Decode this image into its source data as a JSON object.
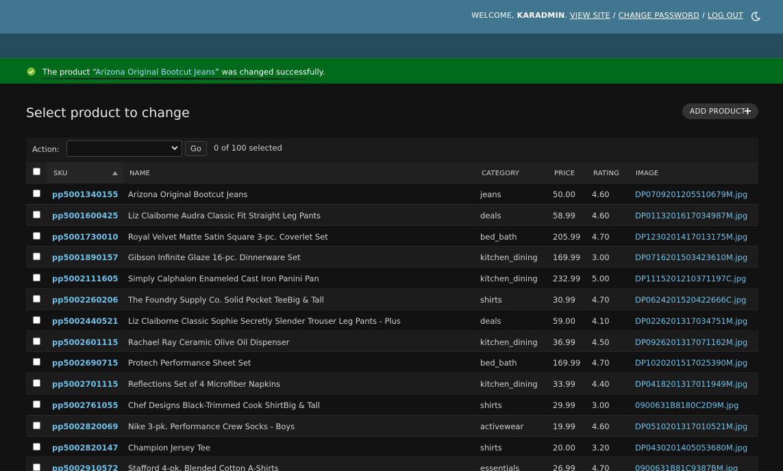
{
  "header": {
    "welcome": "WELCOME,",
    "username": "KARADMIN",
    "view_site": "VIEW SITE",
    "change_password": "CHANGE PASSWORD",
    "log_out": "LOG OUT",
    "separator": "/",
    "theme_icon": "moon-icon"
  },
  "message": {
    "prefix": "The product “",
    "link": "Arizona Original Bootcut Jeans",
    "suffix": "” was changed successfully.",
    "icon": "check-circle-icon",
    "color": "#006b1b"
  },
  "page": {
    "title": "Select product to change",
    "add_button": "ADD PRODUCT",
    "add_icon": "plus-icon"
  },
  "actions": {
    "label": "Action:",
    "selected_value": "",
    "go_label": "Go",
    "selected_count": "0 of 100 selected"
  },
  "table": {
    "columns": [
      "SKU",
      "NAME",
      "CATEGORY",
      "PRICE",
      "RATING",
      "IMAGE"
    ],
    "sorted_column": "SKU",
    "rows": [
      {
        "sku": "pp5001340155",
        "name": "Arizona Original Bootcut Jeans",
        "category": "jeans",
        "price": "50.00",
        "rating": "4.60",
        "image": "DP0709201205510679M.jpg"
      },
      {
        "sku": "pp5001600425",
        "name": "Liz Claiborne Audra Classic Fit Straight Leg Pants",
        "category": "deals",
        "price": "58.99",
        "rating": "4.60",
        "image": "DP0113201617034987M.jpg"
      },
      {
        "sku": "pp5001730010",
        "name": "Royal Velvet Matte Satin Square 3-pc. Coverlet Set",
        "category": "bed_bath",
        "price": "205.99",
        "rating": "4.70",
        "image": "DP1230201417013175M.jpg"
      },
      {
        "sku": "pp5001890157",
        "name": "Gibson Infinite Glaze 16-pc. Dinnerware Set",
        "category": "kitchen_dining",
        "price": "169.99",
        "rating": "3.00",
        "image": "DP0716201503423610M.jpg"
      },
      {
        "sku": "pp5002111605",
        "name": "Simply Calphalon Enameled Cast Iron Panini Pan",
        "category": "kitchen_dining",
        "price": "232.99",
        "rating": "5.00",
        "image": "DP1115201210371197C.jpg"
      },
      {
        "sku": "pp5002260206",
        "name": "The Foundry Supply Co. Solid Pocket TeeBig & Tall",
        "category": "shirts",
        "price": "30.99",
        "rating": "4.70",
        "image": "DP0624201520422666C.jpg"
      },
      {
        "sku": "pp5002440521",
        "name": "Liz Claiborne Classic Sophie Secretly Slender Trouser Leg Pants - Plus",
        "category": "deals",
        "price": "59.00",
        "rating": "4.10",
        "image": "DP0226201317034751M.jpg"
      },
      {
        "sku": "pp5002601115",
        "name": "Rachael Ray Ceramic Olive Oil Dispenser",
        "category": "kitchen_dining",
        "price": "36.99",
        "rating": "4.50",
        "image": "DP0926201317071162M.jpg"
      },
      {
        "sku": "pp5002690715",
        "name": "Protech Performance Sheet Set",
        "category": "bed_bath",
        "price": "169.99",
        "rating": "4.70",
        "image": "DP1020201517025390M.jpg"
      },
      {
        "sku": "pp5002701115",
        "name": "Reflections Set of 4 Microfiber Napkins",
        "category": "kitchen_dining",
        "price": "33.99",
        "rating": "4.40",
        "image": "DP0418201317011949M.jpg"
      },
      {
        "sku": "pp5002761055",
        "name": "Chef Designs Black-Trimmed Cook ShirtBig & Tall",
        "category": "shirts",
        "price": "29.99",
        "rating": "3.00",
        "image": "0900631B8180C2D9M.jpg"
      },
      {
        "sku": "pp5002820069",
        "name": "Nike 3-pk. Performance Crew Socks - Boys",
        "category": "activewear",
        "price": "19.99",
        "rating": "4.60",
        "image": "DP0510201317010521M.jpg"
      },
      {
        "sku": "pp5002820147",
        "name": "Champion Jersey Tee",
        "category": "shirts",
        "price": "20.00",
        "rating": "3.20",
        "image": "DP0430201405053680M.jpg"
      },
      {
        "sku": "pp5002910572",
        "name": "Stafford 4-pk. Blended Cotton A-Shirts",
        "category": "essentials",
        "price": "26.99",
        "rating": "4.70",
        "image": "0900631B81C9387BM.jpg"
      }
    ]
  }
}
